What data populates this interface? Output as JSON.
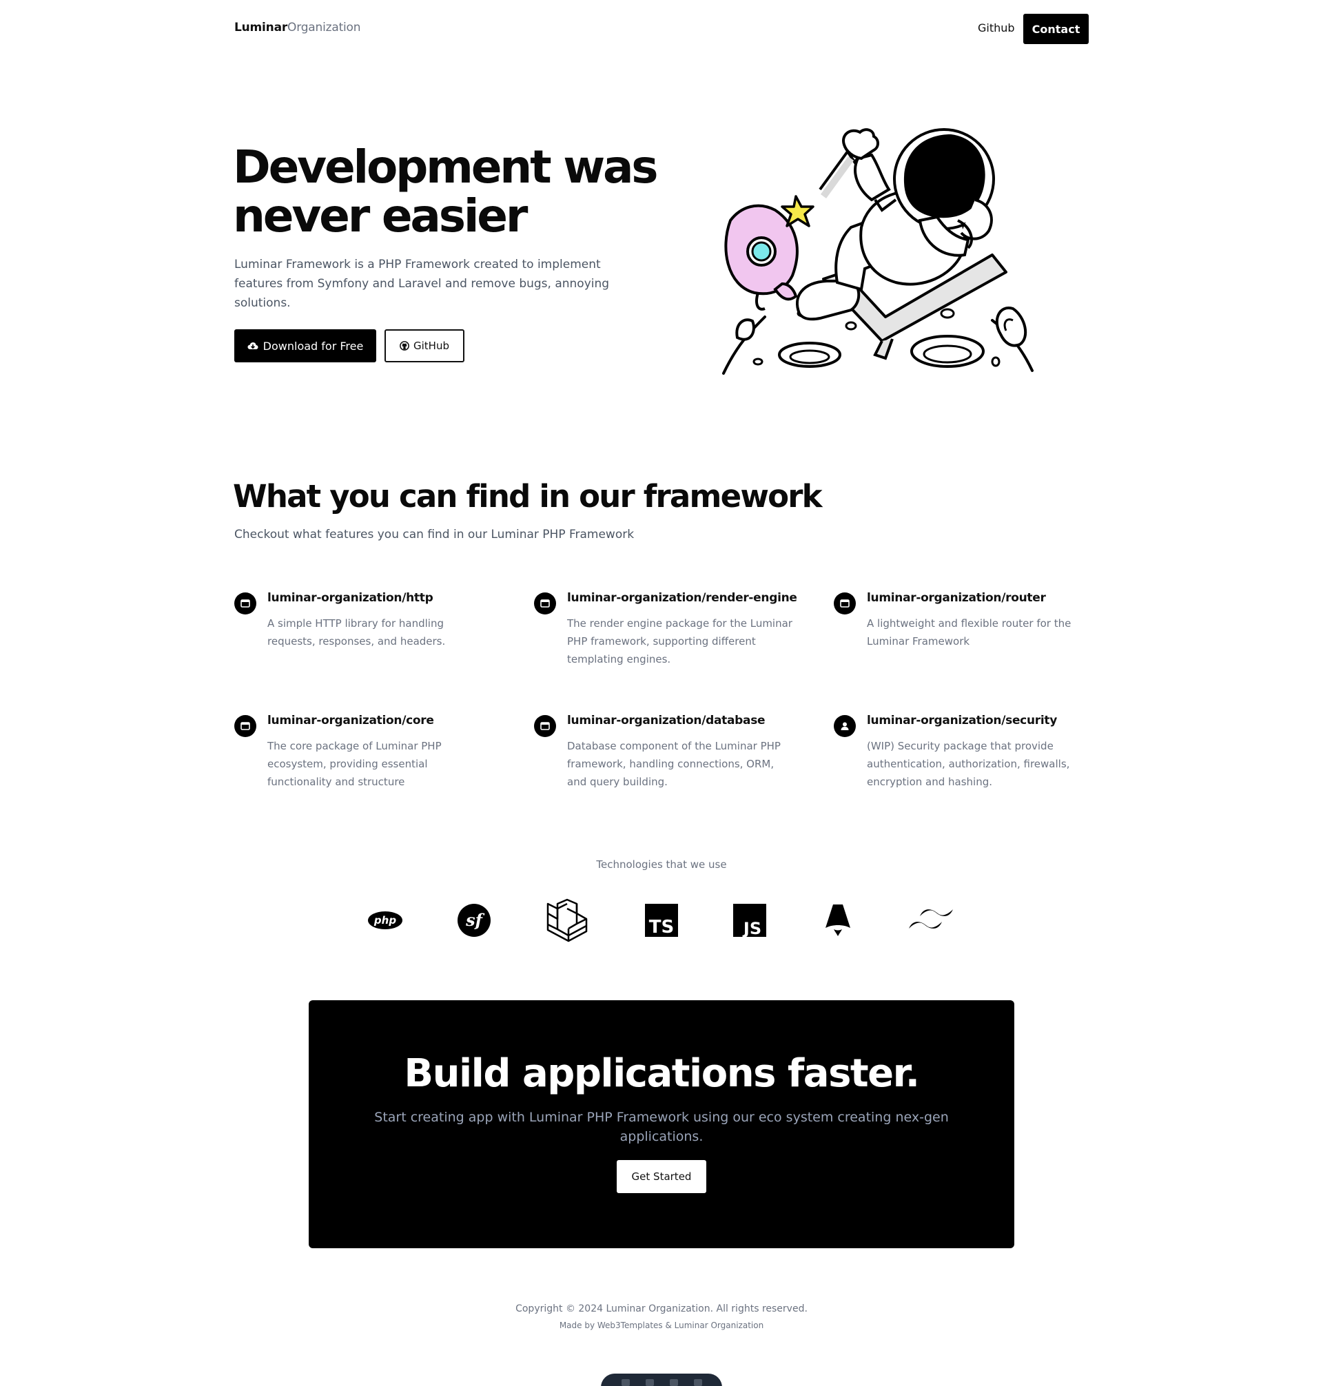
{
  "header": {
    "logo_bold": "Luminar",
    "logo_light": "Organization",
    "nav_github": "Github",
    "contact_label": "Contact"
  },
  "hero": {
    "title_line1": "Development was",
    "title_line2": "never easier",
    "description": "Luminar Framework is a PHP Framework created to implement features from Symfony and Laravel and remove bugs, annoying solutions.",
    "download_label": "Download for Free",
    "github_label": "GitHub",
    "illustration": "astronaut-rocket-illustration"
  },
  "features": {
    "title": "What you can find in our framework",
    "subtitle": "Checkout what features you can find in our Luminar PHP Framework",
    "items": [
      {
        "name": "luminar-organization/http",
        "description": "A simple HTTP library for handling requests, responses, and headers.",
        "icon": "window-icon"
      },
      {
        "name": "luminar-organization/render-engine",
        "description": "The render engine package for the Luminar PHP framework, supporting different templating engines.",
        "icon": "window-icon"
      },
      {
        "name": "luminar-organization/router",
        "description": "A lightweight and flexible router for the Luminar Framework",
        "icon": "window-icon"
      },
      {
        "name": "luminar-organization/core",
        "description": "The core package of Luminar PHP ecosystem, providing essential functionality and structure",
        "icon": "window-icon"
      },
      {
        "name": "luminar-organization/database",
        "description": "Database component of the Luminar PHP framework, handling connections, ORM, and query building.",
        "icon": "window-icon"
      },
      {
        "name": "luminar-organization/security",
        "description": "(WIP) Security package that provide authentication, authorization, firewalls, encryption and hashing.",
        "icon": "user-icon"
      }
    ]
  },
  "technologies": {
    "caption": "Technologies that we use",
    "logos": [
      {
        "name": "php-logo",
        "text": "php"
      },
      {
        "name": "symfony-logo",
        "text": "sf"
      },
      {
        "name": "laravel-logo",
        "text": ""
      },
      {
        "name": "typescript-logo",
        "text": "TS"
      },
      {
        "name": "javascript-logo",
        "text": "JS"
      },
      {
        "name": "astro-logo",
        "text": ""
      },
      {
        "name": "tailwind-logo",
        "text": ""
      }
    ]
  },
  "cta": {
    "title": "Build applications faster.",
    "description": "Start creating app with Luminar PHP Framework using our eco system creating nex-gen applications.",
    "button_label": "Get Started"
  },
  "footer": {
    "copyright": "Copyright © 2024 Luminar Organization. All rights reserved.",
    "made_by": "Made by Web3Templates & Luminar Organization"
  },
  "colors": {
    "text_primary": "#0a0a0a",
    "text_muted": "#6b7280",
    "button_dark": "#000000",
    "cta_text": "#9aa4b8"
  }
}
